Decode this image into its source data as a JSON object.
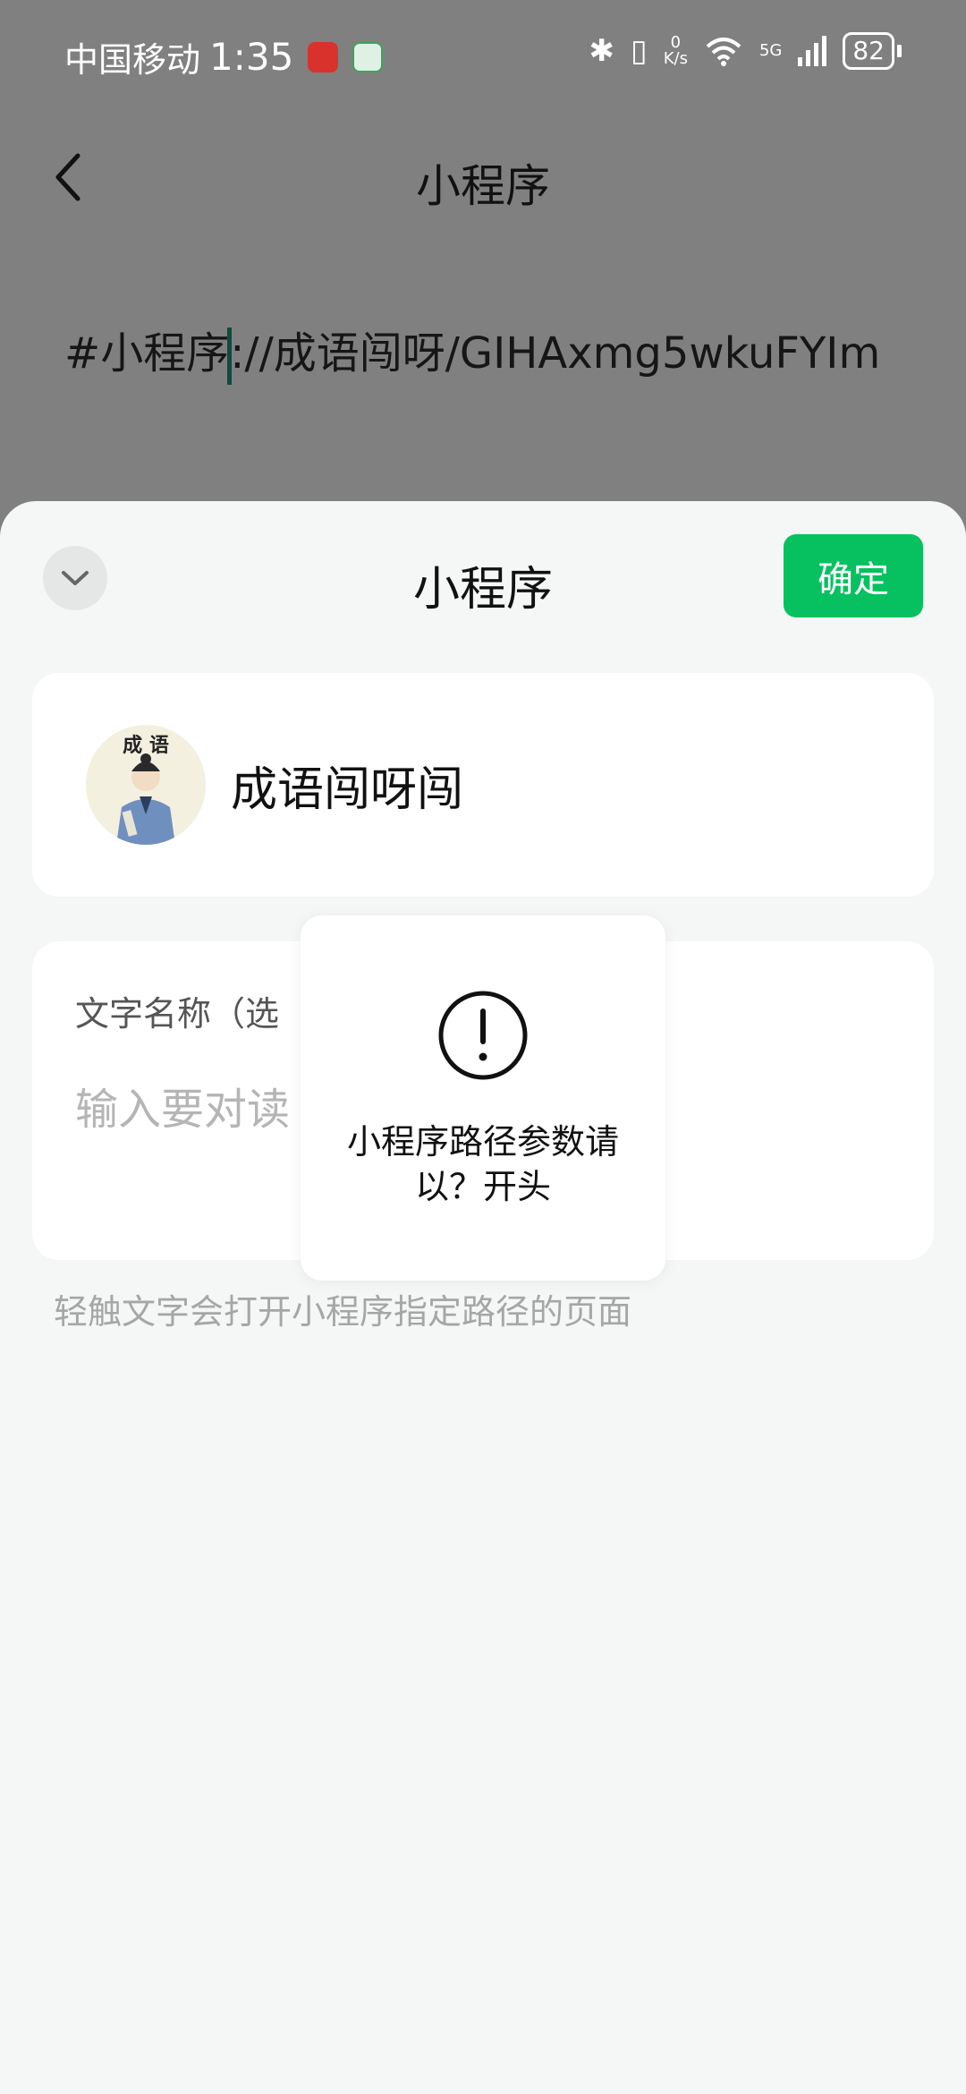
{
  "status_bar": {
    "carrier": "中国移动",
    "time": "1:35",
    "speed_value": "0",
    "speed_unit": "K/s",
    "network": "5G",
    "battery": "82"
  },
  "nav": {
    "title": "小程序"
  },
  "content": {
    "text_before_cursor": "#小程序",
    "text_after_cursor": "://成语闯呀/GIHAxmg5wkuFYIm"
  },
  "sheet": {
    "title": "小程序",
    "confirm_label": "确定",
    "app_name": "成语闯呀闯",
    "avatar_caption": "成 语",
    "field_label": "文字名称（选",
    "field_placeholder": "输入要对读",
    "hint": "轻触文字会打开小程序指定路径的页面"
  },
  "toast": {
    "message": "小程序路径参数请以？开头"
  },
  "colors": {
    "accent": "#07c160",
    "dim_overlay": "#808080"
  }
}
